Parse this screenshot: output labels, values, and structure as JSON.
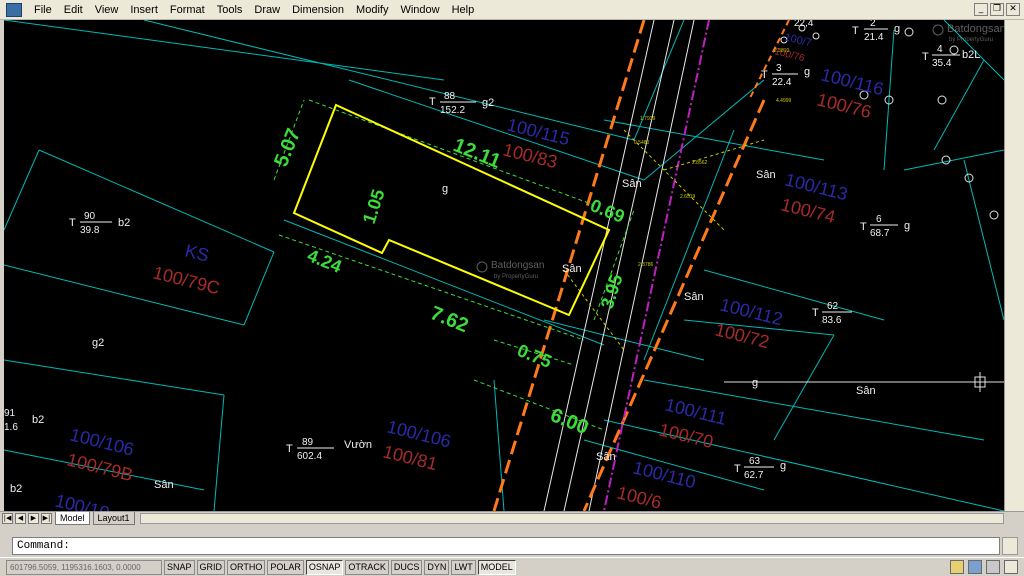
{
  "menu": [
    "File",
    "Edit",
    "View",
    "Insert",
    "Format",
    "Tools",
    "Draw",
    "Dimension",
    "Modify",
    "Window",
    "Help"
  ],
  "window_controls": [
    "_",
    "❐",
    "✕"
  ],
  "drawing": {
    "dimensions": {
      "d_1211": "12.11",
      "d_507": "5.07",
      "d_105": "1.05",
      "d_424": "4.24",
      "d_762": "7.62",
      "d_069": "0.69",
      "d_395": "3.95",
      "d_075": "0.75",
      "d_600": "6.00"
    },
    "parcels": [
      {
        "num": "88",
        "area": "152.2",
        "suffix": "g2"
      },
      {
        "num": "90",
        "area": "39.8",
        "suffix": "b2"
      },
      {
        "num": "89",
        "area": "602.4",
        "suffix": "Vườn"
      },
      {
        "num": "3",
        "area": "22.4",
        "suffix": "g"
      },
      {
        "num": "62",
        "area": "83.6",
        "suffix": ""
      },
      {
        "num": "6",
        "area": "68.7",
        "suffix": "g"
      },
      {
        "num": "63",
        "area": "62.7",
        "suffix": "g"
      },
      {
        "num": "4",
        "area": "35.4",
        "suffix": "b2L"
      },
      {
        "num": "2",
        "area": "21.4",
        "suffix": "g"
      },
      {
        "num": "91",
        "area": "1.6",
        "suffix": "b2"
      }
    ],
    "lot_codes_blue": [
      "100/115",
      "KS",
      "100/113",
      "100/112",
      "100/111",
      "100/110",
      "100/106",
      "100/106",
      "100/116",
      "100/7",
      "100/10"
    ],
    "lot_codes_red": [
      "100/83",
      "100/79C",
      "100/74",
      "100/72",
      "100/70",
      "100/6",
      "100/79B",
      "100/81",
      "100/76",
      "100/76"
    ],
    "white_labels": [
      "g",
      "g2",
      "Sân",
      "Sân",
      "Sân",
      "Sân",
      "Sân",
      "Sân",
      "g",
      "b2",
      "22,4",
      "Sân"
    ],
    "watermark": {
      "brand": "Batdongsan",
      "sub": "by PropertyGuru",
      "com": ".com.vn"
    },
    "tiny": [
      "1.7939",
      "0.5480",
      "2.8562",
      "2.6519",
      "2.3786",
      "4.4999",
      "2.3810"
    ],
    "colors": {
      "parcel_outline": "#00c8c8",
      "highlight": "#ffff00",
      "dimension": "#3ddc3d",
      "lot_blue": "#2a2aa8",
      "lot_red": "#a82a2a",
      "road_orange": "#ff7a1a",
      "road_magenta": "#c020c0"
    }
  },
  "tabs": {
    "nav": [
      "|◀",
      "◀",
      "▶",
      "▶|"
    ],
    "model": "Model",
    "layout1": "Layout1"
  },
  "command": {
    "prompt": "Command:"
  },
  "status": {
    "coords": "601796.5059, 1195316.1603, 0.0000",
    "buttons": [
      {
        "label": "SNAP",
        "on": false
      },
      {
        "label": "GRID",
        "on": false
      },
      {
        "label": "ORTHO",
        "on": false
      },
      {
        "label": "POLAR",
        "on": false
      },
      {
        "label": "OSNAP",
        "on": true
      },
      {
        "label": "OTRACK",
        "on": false
      },
      {
        "label": "DUCS",
        "on": false
      },
      {
        "label": "DYN",
        "on": false
      },
      {
        "label": "LWT",
        "on": false
      },
      {
        "label": "MODEL",
        "on": true
      }
    ]
  }
}
